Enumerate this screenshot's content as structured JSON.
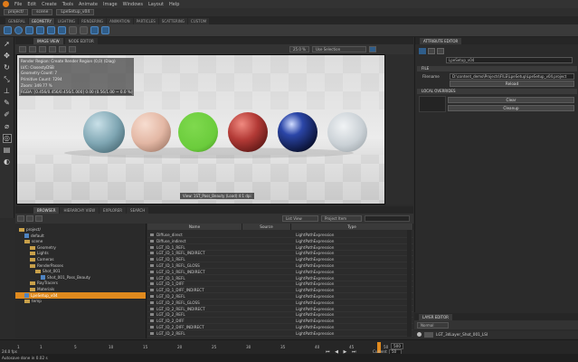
{
  "menu": [
    "File",
    "Edit",
    "Create",
    "Tools",
    "Animate",
    "Image",
    "Windows",
    "Layout",
    "Help"
  ],
  "project": {
    "crumbs": [
      "project/",
      "scene",
      "LpeSetup_v04"
    ]
  },
  "workspace_tabs": [
    "GENERAL",
    "GEOMETRY",
    "LIGHTING",
    "RENDERING",
    "ANIMATION",
    "PARTICLES",
    "SCATTERING",
    "CUSTOM"
  ],
  "viewer": {
    "tabs": [
      "IMAGE VIEW",
      "NODE EDITOR"
    ],
    "zoom": "25.0 %",
    "selection_mode": "Use Selection",
    "hud": [
      "Render Region: Create Render Region (0,0) (Diag)",
      "LVC: ClosestyDSB",
      "Geometry Count: 7",
      "Primitive Count: 7294",
      "Zoom: 349.77 %",
      "RGBA: [0.456/0.456/0.456/1.000] 0.00 (0.56/1.00 ~ 0.0 %)"
    ],
    "caption": "View: 1ST_Pass_Beauty (Load) 4:1 dpi"
  },
  "attribute_editor": {
    "tab": "ATTRIBUTE EDITOR",
    "node_name": "LpeSetup_v04",
    "section_file": "FILE",
    "filename_label": "Filename",
    "filename_value": "D:\\content_demo\\Projects\\FILE\\LpeSetup\\LpeSetup_v04.project",
    "reload": "Reload",
    "section_overrides": "LOCAL OVERRIDES",
    "clear": "Clear",
    "cleanup": "Cleanup"
  },
  "browser": {
    "tabs": [
      "BROWSER",
      "HIERARCHY VIEW",
      "EXPLORER",
      "SEARCH"
    ],
    "list_view": "List View",
    "project_item": "Project Item",
    "tree": [
      {
        "label": "project/",
        "depth": 0,
        "type": "folder"
      },
      {
        "label": "default",
        "depth": 1,
        "type": "file"
      },
      {
        "label": "scene",
        "depth": 1,
        "type": "folder"
      },
      {
        "label": "Geometry",
        "depth": 2,
        "type": "folder"
      },
      {
        "label": "Lights",
        "depth": 2,
        "type": "folder"
      },
      {
        "label": "Cameras",
        "depth": 2,
        "type": "folder"
      },
      {
        "label": "RenderPasses",
        "depth": 2,
        "type": "folder"
      },
      {
        "label": "Shot_001",
        "depth": 3,
        "type": "folder"
      },
      {
        "label": "Shot_001_Pass_Beauty",
        "depth": 4,
        "type": "file"
      },
      {
        "label": "RayTracers",
        "depth": 2,
        "type": "folder"
      },
      {
        "label": "Materials",
        "depth": 2,
        "type": "folder"
      },
      {
        "label": "LpeSetup_v04",
        "depth": 1,
        "type": "file",
        "selected": true
      },
      {
        "label": "temp",
        "depth": 1,
        "type": "folder"
      }
    ],
    "columns": [
      "Name",
      "Source",
      "Type"
    ],
    "rows": [
      {
        "name": "Diffuse_direct",
        "type": "LightPathExpression"
      },
      {
        "name": "Diffuse_indirect",
        "type": "LightPathExpression"
      },
      {
        "name": "LGT_ID_1_REFL",
        "type": "LightPathExpression"
      },
      {
        "name": "LGT_ID_1_REFL_INDIRECT",
        "type": "LightPathExpression"
      },
      {
        "name": "LGT_ID_1_REFL",
        "type": "LightPathExpression"
      },
      {
        "name": "LGT_ID_1_REFL_GLOSS",
        "type": "LightPathExpression"
      },
      {
        "name": "LGT_ID_1_REFL_INDIRECT",
        "type": "LightPathExpression"
      },
      {
        "name": "LGT_ID_1_REFL",
        "type": "LightPathExpression"
      },
      {
        "name": "LGT_ID_1_DIFF",
        "type": "LightPathExpression"
      },
      {
        "name": "LGT_ID_1_DIFF_INDIRECT",
        "type": "LightPathExpression"
      },
      {
        "name": "LGT_ID_2_REFL",
        "type": "LightPathExpression"
      },
      {
        "name": "LGT_ID_2_REFL_GLOSS",
        "type": "LightPathExpression"
      },
      {
        "name": "LGT_ID_2_REFL_INDIRECT",
        "type": "LightPathExpression"
      },
      {
        "name": "LGT_ID_2_REFL",
        "type": "LightPathExpression"
      },
      {
        "name": "LGT_ID_2_DIFF",
        "type": "LightPathExpression"
      },
      {
        "name": "LGT_ID_2_DIFF_INDIRECT",
        "type": "LightPathExpression"
      },
      {
        "name": "LGT_ID_2_REFL",
        "type": "LightPathExpression"
      }
    ]
  },
  "layer_editor": {
    "tab": "LAYER EDITOR",
    "mode": "Normal",
    "layer_name": "LGT_3dLayer_Shot_001_LSI"
  },
  "timeline": {
    "start": "1",
    "ticks": [
      "1",
      "5",
      "10",
      "15",
      "20",
      "25",
      "30",
      "35",
      "40",
      "45",
      "50"
    ],
    "end_field": "500",
    "current_label": "Current",
    "current_value": "50"
  },
  "status": {
    "fps": "24.0 fps",
    "message": "Autosave done in 0.02 s"
  },
  "colors": {
    "accent": "#e08a1e",
    "brand_blue": "#2f5d8a",
    "selected_row": "#e08a1e"
  },
  "spheres": [
    {
      "name": "glass-teal",
      "color": "#7fa6b3"
    },
    {
      "name": "skin",
      "color": "#e3b7a4"
    },
    {
      "name": "green",
      "color": "#6bcc3c"
    },
    {
      "name": "red-metal",
      "color": "#b33a36"
    },
    {
      "name": "blue-chrome",
      "color": "#1b2d6e"
    },
    {
      "name": "clear-glass",
      "color": "#c4ccd2"
    }
  ]
}
